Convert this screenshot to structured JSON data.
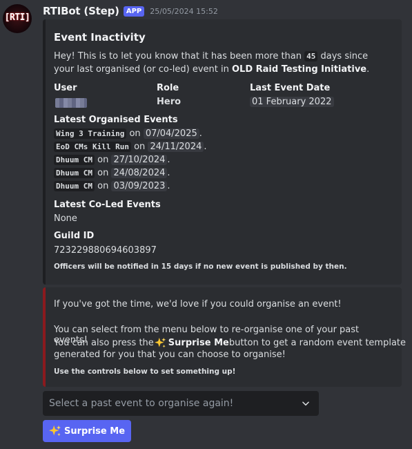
{
  "message": {
    "avatar_text": "[RTI]",
    "author": "RTIBot (Step)",
    "badge": "APP",
    "timestamp": "25/05/2024 15:52"
  },
  "embed1": {
    "title": "Event Inactivity",
    "description_parts": {
      "p1": "Hey! This is to let you know that it has been more than ",
      "days": "45",
      "p2": " days since your last organised (or co-led) event in ",
      "guild_name": "OLD Raid Testing Initiative",
      "p3": "."
    },
    "fields": {
      "user_label": "User",
      "role_label": "Role",
      "role_value": "Hero",
      "last_event_label": "Last Event Date",
      "last_event_value": "01 February 2022"
    },
    "latest_events_label": "Latest Organised Events",
    "latest_events": [
      {
        "name": "Wing 3 Training",
        "on": " on ",
        "date": "07/04/2025",
        "end": "."
      },
      {
        "name": "EoD CMs Kill Run",
        "on": " on ",
        "date": "24/11/2024",
        "end": "."
      },
      {
        "name": "Dhuum CM",
        "on": " on ",
        "date": "27/10/2024",
        "end": "."
      },
      {
        "name": "Dhuum CM",
        "on": " on ",
        "date": "24/08/2024",
        "end": "."
      },
      {
        "name": "Dhuum CM",
        "on": " on ",
        "date": "03/09/2023",
        "end": "."
      }
    ],
    "coled_label": "Latest Co-Led Events",
    "coled_value": "None",
    "guild_id_label": "Guild ID",
    "guild_id_value": "723229880694603897",
    "footer_note": "Officers will be notified in 15 days if no new event is published by then."
  },
  "embed2": {
    "line1": "If you've got the time, we'd love if you could organise an event!",
    "line2": "You can select from the menu below to re-organise one of your past events!",
    "line3a": "You can also press the ",
    "line3_emoji": "sparkles-icon",
    "line3_bold": "Surprise Me",
    "line3b": " button to get a random event template",
    "line4": "generated for you that you can choose to organise!",
    "note": "Use the controls below to set something up!"
  },
  "controls": {
    "select_placeholder": "Select a past event to organise again!",
    "button_label": "Surprise Me",
    "button_icon": "sparkles-icon"
  },
  "colors": {
    "background": "#313338",
    "embed_bg": "#2b2d31",
    "embed2_accent": "#8b1a1e",
    "blurple": "#5865f2"
  }
}
